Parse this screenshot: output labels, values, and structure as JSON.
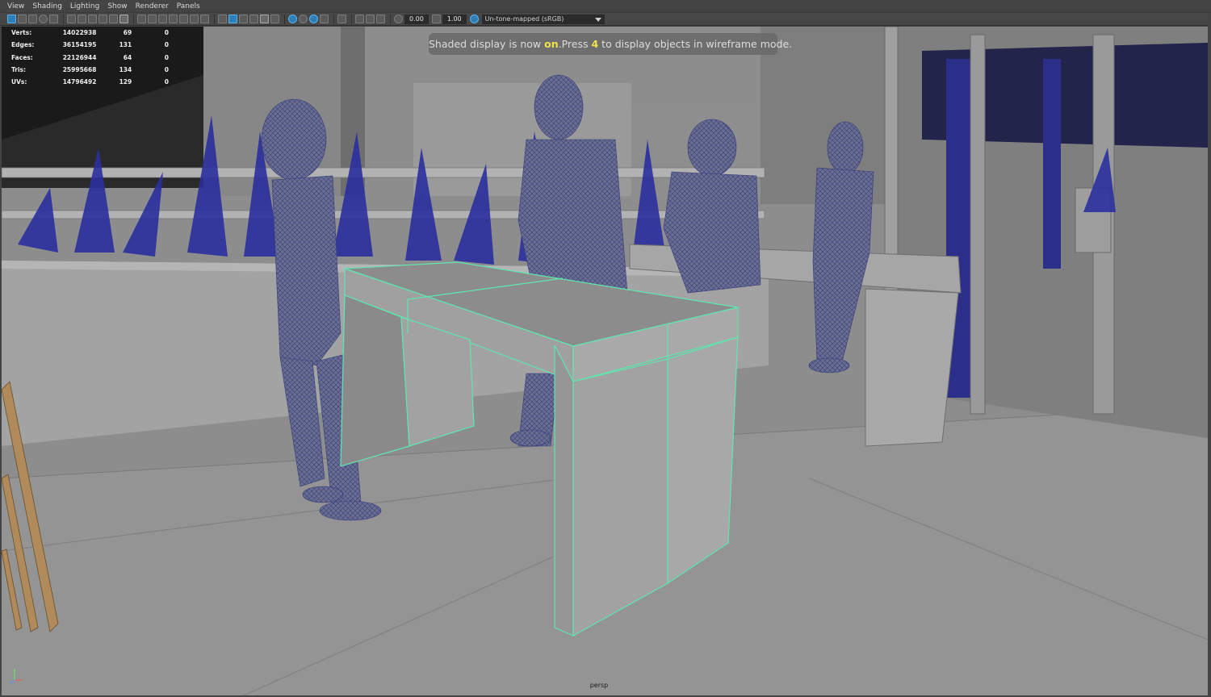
{
  "menubar": {
    "items": [
      "View",
      "Shading",
      "Lighting",
      "Show",
      "Renderer",
      "Panels"
    ]
  },
  "toolbar": {
    "exposure_value": "0.00",
    "gamma_value": "1.00",
    "color_space": "Un-tone-mapped (sRGB)"
  },
  "hud": {
    "before": "Shaded display is now ",
    "state": "on",
    "middle": ".Press ",
    "key": "4",
    "after": " to display objects in wireframe mode."
  },
  "stats": [
    {
      "label": "Verts:",
      "total": "14022938",
      "selected": "69",
      "components": "0"
    },
    {
      "label": "Edges:",
      "total": "36154195",
      "selected": "131",
      "components": "0"
    },
    {
      "label": "Faces:",
      "total": "22126944",
      "selected": "64",
      "components": "0"
    },
    {
      "label": "Tris:",
      "total": "25995668",
      "selected": "134",
      "components": "0"
    },
    {
      "label": "UVs:",
      "total": "14796492",
      "selected": "129",
      "components": "0"
    }
  ],
  "viewport": {
    "camera": "persp"
  },
  "colors": {
    "selection_highlight": "#5fe6b0",
    "wireframe_blue": "#3a3fa8",
    "ui_background": "#444444"
  }
}
